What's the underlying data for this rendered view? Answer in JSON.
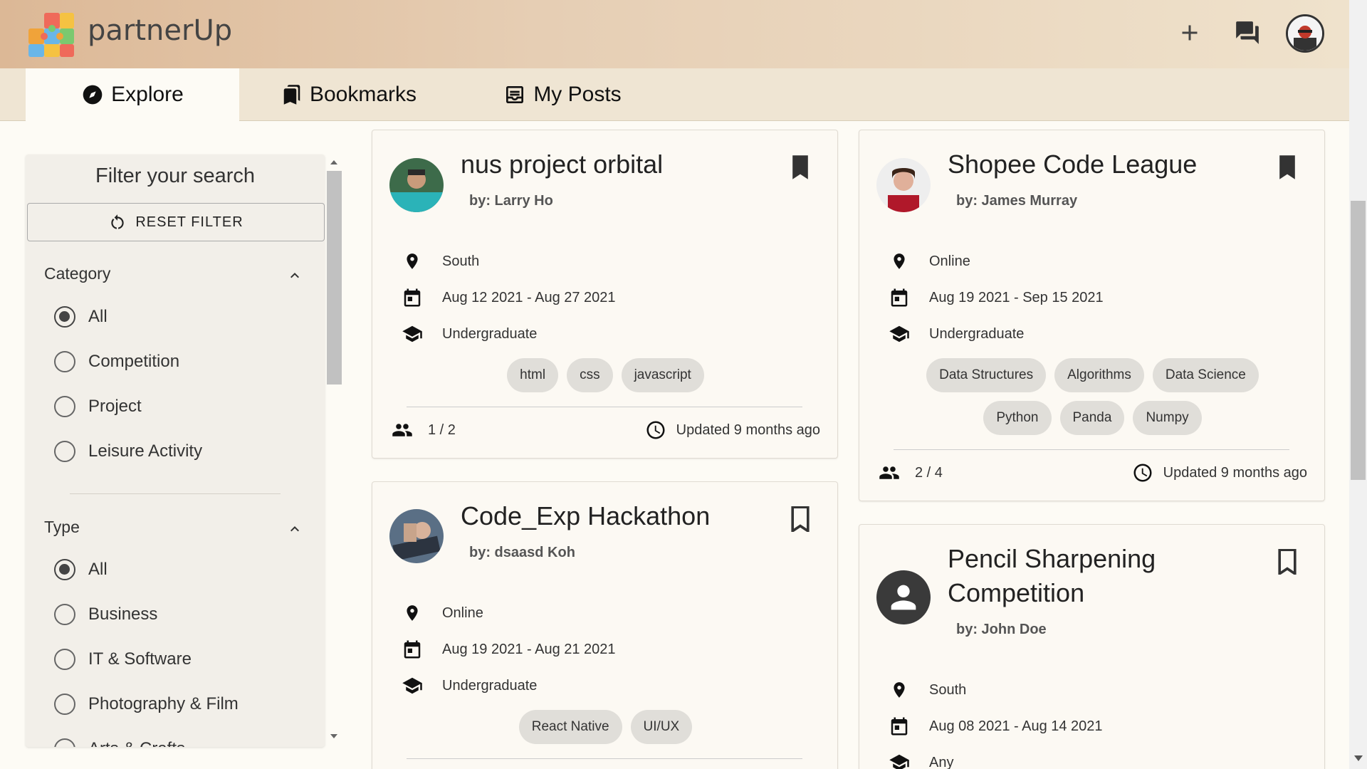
{
  "app": {
    "brand": "partnerUp"
  },
  "tabs": [
    {
      "label": "Explore",
      "active": true
    },
    {
      "label": "Bookmarks",
      "active": false
    },
    {
      "label": "My Posts",
      "active": false
    }
  ],
  "filter": {
    "title": "Filter your search",
    "reset_label": "RESET FILTER",
    "category": {
      "heading": "Category",
      "options": [
        "All",
        "Competition",
        "Project",
        "Leisure Activity"
      ],
      "selected": "All"
    },
    "type": {
      "heading": "Type",
      "options": [
        "All",
        "Business",
        "IT & Software",
        "Photography & Film",
        "Arts & Crafts"
      ],
      "selected": "All"
    }
  },
  "posts": [
    {
      "title": "nus project orbital",
      "author": "by: Larry Ho",
      "location": "South",
      "dates": "Aug 12 2021 - Aug 27 2021",
      "level": "Undergraduate",
      "tags": [
        "html",
        "css",
        "javascript"
      ],
      "members": "1 / 2",
      "updated": "Updated 9 months ago",
      "bookmarked": true
    },
    {
      "title": "Shopee Code League",
      "author": "by: James Murray",
      "location": "Online",
      "dates": "Aug 19 2021 - Sep 15 2021",
      "level": "Undergraduate",
      "tags": [
        "Data Structures",
        "Algorithms",
        "Data Science",
        "Python",
        "Panda",
        "Numpy"
      ],
      "members": "2 / 4",
      "updated": "Updated 9 months ago",
      "bookmarked": true
    },
    {
      "title": "Code_Exp Hackathon",
      "author": "by: dsaasd Koh",
      "location": "Online",
      "dates": "Aug 19 2021 - Aug 21 2021",
      "level": "Undergraduate",
      "tags": [
        "React Native",
        "UI/UX"
      ],
      "bookmarked": false
    },
    {
      "title": "Pencil Sharpening Competition",
      "author": "by: John Doe",
      "location": "South",
      "dates": "Aug 08 2021 - Aug 14 2021",
      "level": "Any",
      "bookmarked": false
    }
  ]
}
